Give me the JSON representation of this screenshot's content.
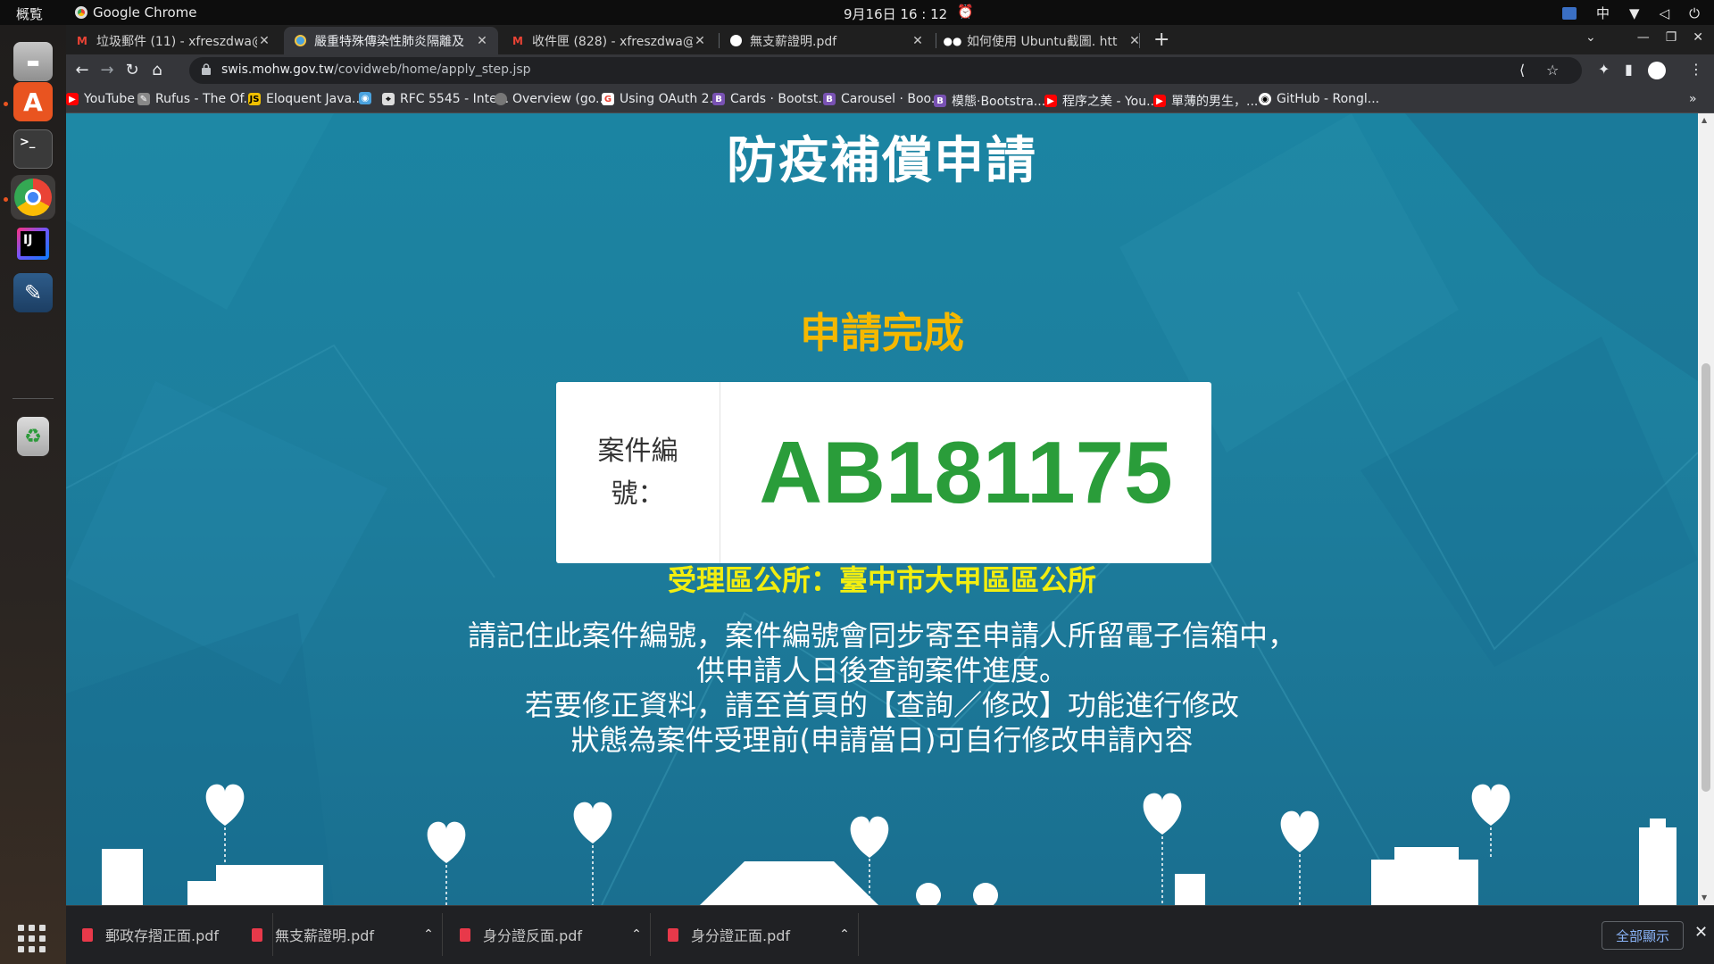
{
  "topbar": {
    "activities": "概覧",
    "app": "Google Chrome",
    "clock": "9月16日  16 : 12",
    "ime": "中"
  },
  "tabs": [
    {
      "title": "垃圾郵件 (11) - xfreszdwa@",
      "favicon": "M",
      "active": false
    },
    {
      "title": "嚴重特殊傳染性肺炎隔離及",
      "favicon": "globe",
      "active": true
    },
    {
      "title": "收件匣 (828) - xfreszdwa@",
      "favicon": "M",
      "active": false
    },
    {
      "title": "無支薪證明.pdf",
      "favicon": "globe",
      "active": false
    },
    {
      "title": "如何使用 Ubuntu截圖. htt",
      "favicon": "medium",
      "active": false
    }
  ],
  "address": {
    "host": "swis.mohw.gov.tw",
    "path": "/covidweb/home/apply_step.jsp"
  },
  "bookmarks": [
    {
      "label": "YouTube",
      "icon": "youtube-icon",
      "color": "#ff0000"
    },
    {
      "label": "Rufus - The Of...",
      "icon": "rufus-icon",
      "color": "#888888"
    },
    {
      "label": "Eloquent Java...",
      "icon": "js-icon",
      "color": "#f0c000"
    },
    {
      "label": "",
      "icon": "globe-icon",
      "color": "#4aa3df"
    },
    {
      "label": "RFC 5545 - Inte...",
      "icon": "rfc-icon",
      "color": "#dddddd"
    },
    {
      "label": "Overview (go...",
      "icon": "globe-icon",
      "color": "#777777"
    },
    {
      "label": "Using OAuth 2...",
      "icon": "google-icon",
      "color": "#ffffff"
    },
    {
      "label": "Cards · Bootst...",
      "icon": "bootstrap-icon",
      "color": "#7952b3"
    },
    {
      "label": "Carousel · Boo...",
      "icon": "bootstrap-icon",
      "color": "#7952b3"
    },
    {
      "label": "模態·Bootstra...",
      "icon": "bootstrap-icon",
      "color": "#7952b3"
    },
    {
      "label": "程序之美 - You...",
      "icon": "youtube-icon",
      "color": "#ff0000"
    },
    {
      "label": "單薄的男生，...",
      "icon": "youtube-icon",
      "color": "#ff0000"
    },
    {
      "label": "GitHub - Rongl...",
      "icon": "github-icon",
      "color": "#ffffff"
    }
  ],
  "page": {
    "title": "防疫補償申請",
    "done": "申請完成",
    "case_label": "案件編號：",
    "case_number": "AB181175",
    "office": "受理區公所：臺中市大甲區區公所",
    "messages": [
      "請記住此案件編號，案件編號會同步寄至申請人所留電子信箱中，",
      "供申請人日後查詢案件進度。",
      "若要修正資料，請至首頁的【查詢／修改】功能進行修改",
      "狀態為案件受理前(申請當日)可自行修改申請內容"
    ]
  },
  "downloads": [
    {
      "name": "郵政存摺正面.pdf"
    },
    {
      "name": "無支薪證明.pdf"
    },
    {
      "name": "身分證反面.pdf"
    },
    {
      "name": "身分證正面.pdf"
    }
  ],
  "shelf": {
    "show_all": "全部顯示"
  },
  "colors": {
    "page_bg": "#1b84a2",
    "done": "#f5b800",
    "case_number": "#2a9d3a",
    "office": "#f2ee10"
  }
}
